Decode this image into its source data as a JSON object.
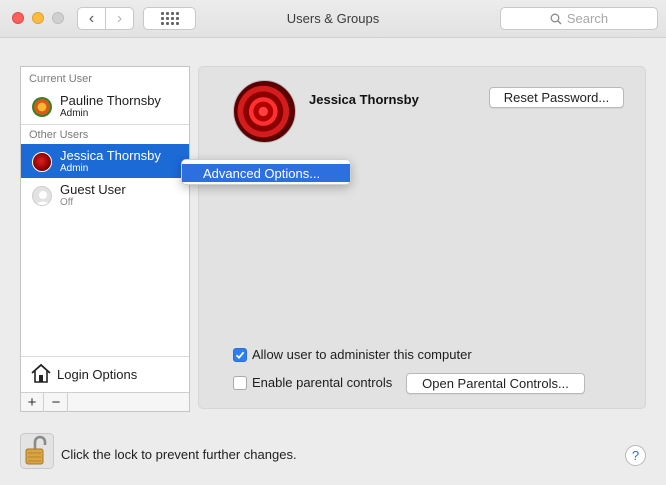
{
  "window": {
    "title": "Users & Groups",
    "back_glyph": "‹",
    "forward_glyph": "›"
  },
  "search": {
    "placeholder": "Search",
    "icon": "search-icon"
  },
  "sidebar": {
    "current_user_header": "Current User",
    "other_users_header": "Other Users",
    "users": [
      {
        "name": "Pauline Thornsby",
        "role": "Admin",
        "avatar": "flower-avatar",
        "selected": false
      },
      {
        "name": "Jessica Thornsby",
        "role": "Admin",
        "avatar": "rose-avatar",
        "selected": true
      },
      {
        "name": "Guest User",
        "role": "Off",
        "avatar": "guest-avatar",
        "selected": false
      }
    ],
    "login_options_label": "Login Options",
    "add_glyph": "+",
    "remove_glyph": "−"
  },
  "context_menu": {
    "items": [
      "Advanced Options..."
    ]
  },
  "main": {
    "selected_user_name": "Jessica Thornsby",
    "reset_password_label": "Reset Password...",
    "allow_admin_label": "Allow user to administer this computer",
    "allow_admin_checked": true,
    "parental_controls_label": "Enable parental controls",
    "parental_controls_checked": false,
    "open_parental_controls_label": "Open Parental Controls..."
  },
  "footer": {
    "lock_text": "Click the lock to prevent further changes.",
    "help_glyph": "?"
  },
  "colors": {
    "selection": "#1c6ad6",
    "menu_highlight": "#2d6fdf",
    "checkbox_checked": "#2e7ef2"
  }
}
